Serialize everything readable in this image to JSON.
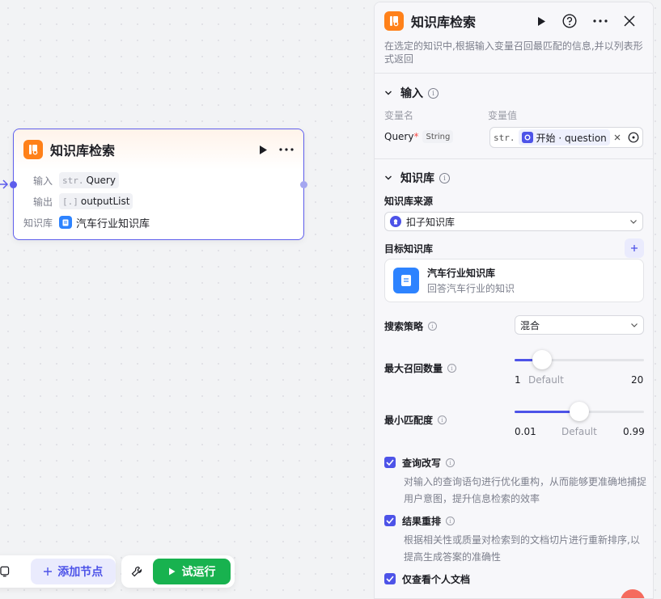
{
  "node": {
    "title": "知识库检索",
    "input_label": "输入",
    "input_type": "str.",
    "input_value": "Query",
    "output_label": "输出",
    "output_type": "[.]",
    "output_value": "outputList",
    "kb_label": "知识库",
    "kb_value": "汽车行业知识库"
  },
  "toolbar": {
    "add_node": "添加节点",
    "test_run": "试运行"
  },
  "panel": {
    "title": "知识库检索",
    "description": "在选定的知识中,根据输入变量召回最匹配的信息,并以列表形式返回",
    "input_section": {
      "title": "输入",
      "col_name": "变量名",
      "col_value": "变量值",
      "var_name": "Query",
      "required_mark": "*",
      "var_type": "String",
      "value_prefix": "str.",
      "value_ref": "开始 · question"
    },
    "kb_section": {
      "title": "知识库",
      "source_label": "知识库来源",
      "source_value": "扣子知识库",
      "target_label": "目标知识库",
      "kb_name": "汽车行业知识库",
      "kb_desc": "回答汽车行业的知识"
    },
    "search_strategy": {
      "label": "搜索策略",
      "value": "混合"
    },
    "max_recall": {
      "label": "最大召回数量",
      "min": "1",
      "default_label": "Default",
      "max": "20",
      "value": 5
    },
    "min_match": {
      "label": "最小匹配度",
      "min": "0.01",
      "default_label": "Default",
      "max": "0.99",
      "value": 0.5
    },
    "query_rewrite": {
      "label": "查询改写",
      "desc": "对输入的查询语句进行优化重构，从而能够更准确地捕捉用户意图，提升信息检索的效率",
      "checked": true
    },
    "rerank": {
      "label": "结果重排",
      "desc": "根据相关性或质量对检索到的文档切片进行重新排序,以提高生成答案的准确性",
      "checked": true
    },
    "personal_only": {
      "label": "仅查看个人文档",
      "checked": true
    }
  },
  "colors": {
    "accent": "#4d53e8",
    "node_icon": "#ff811a",
    "run_button": "#18b24f",
    "kb_icon": "#2d83ff"
  }
}
